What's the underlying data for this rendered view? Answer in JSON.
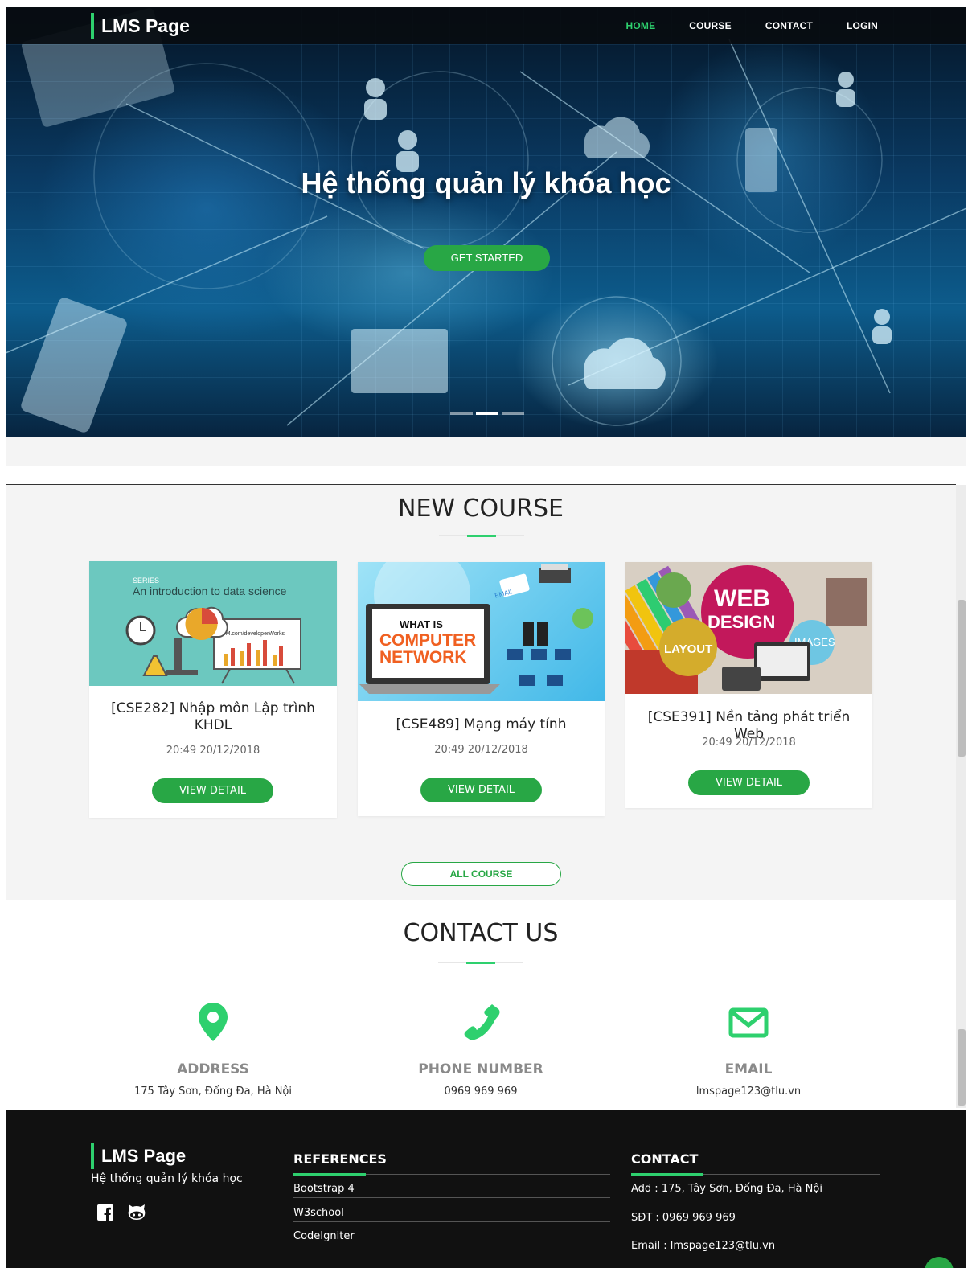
{
  "navbar": {
    "brand": "LMS Page",
    "links": [
      {
        "label": "HOME",
        "active": true
      },
      {
        "label": "COURSE",
        "active": false
      },
      {
        "label": "CONTACT",
        "active": false
      },
      {
        "label": "LOGIN",
        "active": false
      }
    ]
  },
  "hero": {
    "title": "Hệ thống quản lý khóa học",
    "button_label": "GET STARTED",
    "slide_count": 3,
    "active_slide": 2
  },
  "courses": {
    "section_title": "NEW COURSE",
    "items": [
      {
        "title": "[CSE282] Nhập môn Lập trình KHDL",
        "date": "20:49 20/12/2018",
        "button_label": "VIEW DETAIL",
        "image": {
          "series": "SERIES",
          "heading": "An introduction to data science",
          "board_text": "IBM.com/developerWorks"
        }
      },
      {
        "title": "[CSE489] Mạng máy tính",
        "date": "20:49 20/12/2018",
        "button_label": "VIEW DETAIL",
        "image": {
          "line1": "WHAT IS",
          "line2": "COMPUTER",
          "line3": "NETWORK",
          "tag": "EMAIL"
        }
      },
      {
        "title": "[CSE391] Nền tảng phát triển Web",
        "date": "20:49 20/12/2018",
        "button_label": "VIEW DETAIL",
        "image": {
          "line1": "WEB",
          "line2": "DESIGN",
          "tag1": "LAYOUT",
          "tag2": "IMAGES"
        }
      }
    ],
    "all_course_label": "ALL COURSE"
  },
  "contact_us": {
    "section_title": "CONTACT US",
    "items": [
      {
        "icon": "map-pin-icon",
        "label": "ADDRESS",
        "value": "175 Tây Sơn, Đống Đa, Hà Nội"
      },
      {
        "icon": "phone-icon",
        "label": "PHONE NUMBER",
        "value": "0969 969 969"
      },
      {
        "icon": "envelope-icon",
        "label": "EMAIL",
        "value": "lmspage123@tlu.vn"
      }
    ]
  },
  "footer": {
    "brand": "LMS Page",
    "tagline": "Hệ thống quản lý khóa học",
    "social": [
      {
        "icon": "facebook-icon"
      },
      {
        "icon": "github-icon"
      }
    ],
    "references": {
      "heading": "REFERENCES",
      "links": [
        "Bootstrap 4",
        "W3school",
        "CodeIgniter"
      ]
    },
    "contact": {
      "heading": "CONTACT",
      "lines": [
        "Add : 175, Tây Sơn, Đống Đa, Hà Nội",
        "SĐT : 0969 969 969",
        "Email : lmspage123@tlu.vn"
      ]
    }
  },
  "colors": {
    "accent": "#2ed06e",
    "button": "#28a745",
    "footer_bg": "#111111",
    "section_bg": "#f4f4f4"
  }
}
